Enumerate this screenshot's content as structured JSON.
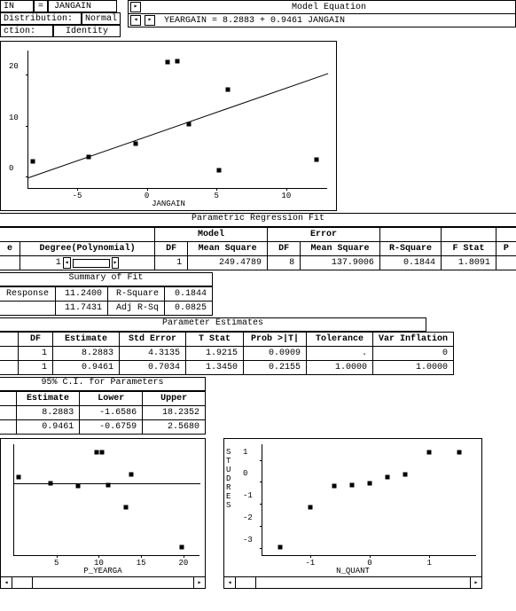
{
  "header": {
    "left": [
      [
        "IN",
        "=",
        "JANGAIN"
      ],
      [
        "Distribution:",
        "Normal"
      ],
      [
        "ction:",
        "Identity"
      ]
    ],
    "model_eq_title": "Model Equation",
    "model_eq": "YEARGAIN   =    8.2883    +    0.9461  JANGAIN"
  },
  "chart_data": {
    "type": "scatter",
    "xlabel": "JANGAIN",
    "x_range": [
      -8.5,
      13
    ],
    "y_range": [
      -2,
      25
    ],
    "x_ticks": [
      -5,
      0,
      5,
      10
    ],
    "y_ticks": [
      0,
      10,
      20
    ],
    "points": [
      {
        "x": -8.2,
        "y": 3.2
      },
      {
        "x": -4.2,
        "y": 4.0
      },
      {
        "x": -0.8,
        "y": 6.6
      },
      {
        "x": 1.5,
        "y": 22.6
      },
      {
        "x": 2.2,
        "y": 22.8
      },
      {
        "x": 3.0,
        "y": 10.4
      },
      {
        "x": 5.2,
        "y": 1.4
      },
      {
        "x": 5.8,
        "y": 17.2
      },
      {
        "x": 12.2,
        "y": 3.6
      }
    ],
    "fit_line": {
      "intercept": 8.2883,
      "slope": 0.9461
    }
  },
  "prf": {
    "title": "Parametric Regression Fit",
    "headers_top": [
      "",
      "",
      "Model",
      "Error",
      "",
      "",
      ""
    ],
    "headers": [
      "e",
      "Degree(Polynomial)",
      "DF",
      "Mean Square",
      "DF",
      "Mean Square",
      "R-Square",
      "F Stat",
      "P"
    ],
    "row": [
      "",
      "1",
      "1",
      "249.4789",
      "8",
      "137.9006",
      "0.1844",
      "1.8091",
      ""
    ]
  },
  "summary": {
    "title": "Summary of Fit",
    "rows": [
      [
        "Response",
        "11.2400",
        "R-Square",
        "0.1844"
      ],
      [
        "",
        "11.7431",
        "Adj R-Sq",
        "0.0825"
      ]
    ]
  },
  "param_est": {
    "title": "Parameter Estimates",
    "headers": [
      "",
      "DF",
      "Estimate",
      "Std Error",
      "T Stat",
      "Prob >|T|",
      "Tolerance",
      "Var Inflation"
    ],
    "rows": [
      [
        "",
        "1",
        "8.2883",
        "4.3135",
        "1.9215",
        "0.0909",
        ".",
        "0"
      ],
      [
        "",
        "1",
        "0.9461",
        "0.7034",
        "1.3450",
        "0.2155",
        "1.0000",
        "1.0000"
      ]
    ]
  },
  "ci": {
    "title": "95% C.I. for Parameters",
    "headers": [
      "",
      "Estimate",
      "Lower",
      "Upper"
    ],
    "rows": [
      [
        "",
        "8.2883",
        "-1.6586",
        "18.2352"
      ],
      [
        "",
        "0.9461",
        "-0.6759",
        "2.5680"
      ]
    ]
  },
  "resid_chart": {
    "type": "scatter",
    "xlabel": "P_YEARGA",
    "x_range": [
      0,
      22
    ],
    "y_range": [
      -3.3,
      1.8
    ],
    "x_ticks": [
      5,
      10,
      15,
      20
    ],
    "points": [
      {
        "x": 0.5,
        "y": 0.25
      },
      {
        "x": 4.3,
        "y": -0.03
      },
      {
        "x": 7.5,
        "y": -0.15
      },
      {
        "x": 9.7,
        "y": 1.4
      },
      {
        "x": 10.4,
        "y": 1.4
      },
      {
        "x": 11.1,
        "y": -0.1
      },
      {
        "x": 13.2,
        "y": -1.1
      },
      {
        "x": 13.8,
        "y": 0.4
      },
      {
        "x": 19.8,
        "y": -2.95
      }
    ]
  },
  "nq_chart": {
    "type": "scatter",
    "xlabel": "N_QUANT",
    "ylabel": "STUDRES",
    "x_range": [
      -1.8,
      1.8
    ],
    "y_range": [
      -3.3,
      1.8
    ],
    "x_ticks": [
      -1,
      0,
      1
    ],
    "y_ticks": [
      -3,
      -2,
      -1,
      0,
      1
    ],
    "points": [
      {
        "x": -1.5,
        "y": -2.95
      },
      {
        "x": -1.0,
        "y": -1.1
      },
      {
        "x": -0.6,
        "y": -0.15
      },
      {
        "x": -0.3,
        "y": -0.1
      },
      {
        "x": 0.0,
        "y": -0.03
      },
      {
        "x": 0.3,
        "y": 0.25
      },
      {
        "x": 0.6,
        "y": 0.4
      },
      {
        "x": 1.0,
        "y": 1.4
      },
      {
        "x": 1.5,
        "y": 1.4
      }
    ]
  }
}
